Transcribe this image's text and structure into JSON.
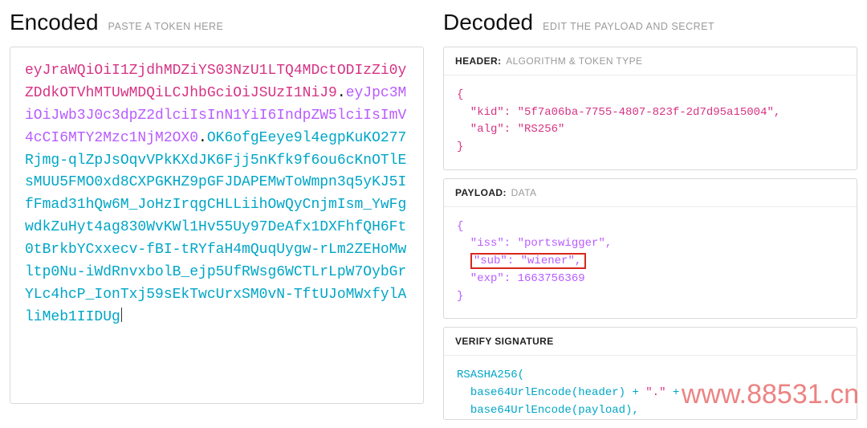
{
  "encoded": {
    "title": "Encoded",
    "subtitle": "PASTE A TOKEN HERE",
    "header": "eyJraWQiOiI1ZjdhMDZiYS03NzU1LTQ4MDctODIzZi0yZDdkOTVhMTUwMDQiLCJhbGciOiJSUzI1NiJ9",
    "payload": "eyJpc3MiOiJwb3J0c3dpZ2dlciIsInN1YiI6IndpZW5lciIsImV4cCI6MTY2Mzc1NjM2OX0",
    "signature": "OK6ofgEeye9l4egpKuKO277Rjmg-qlZpJsOqvVPkKXdJK6Fjj5nKfk9f6ou6cKnOTlEsMUU5FMO0xd8CXPGKHZ9pGFJDAPEMwToWmpn3q5yKJ5IfFmad31hQw6M_JoHzIrqgCHLLiihOwQyCnjmIsm_YwFgwdkZuHyt4ag830WvKWl1Hv55Uy97DeAfx1DXFhfQH6Ft0tBrkbYCxxecv-fBI-tRYfaH4mQuqUygw-rLm2ZEHoMwltp0Nu-iWdRnvxbolB_ejp5UfRWsg6WCTLrLpW7OybGrYLc4hcP_IonTxj59sEkTwcUrxSM0vN-TftUJoMWxfylAliMeb1IIDUg"
  },
  "decoded": {
    "title": "Decoded",
    "subtitle": "EDIT THE PAYLOAD AND SECRET",
    "header_section": {
      "label": "HEADER:",
      "desc": "ALGORITHM & TOKEN TYPE"
    },
    "payload_section": {
      "label": "PAYLOAD:",
      "desc": "DATA"
    },
    "verify_section": {
      "label": "VERIFY SIGNATURE",
      "desc": ""
    },
    "header_json": {
      "kid": "5f7a06ba-7755-4807-823f-2d7d95a15004",
      "alg": "RS256"
    },
    "payload_json": {
      "iss": "portswigger",
      "sub": "wiener",
      "exp": 1663756369
    },
    "highlight_key": "sub",
    "verify": {
      "fn": "RSASHA256(",
      "line1a": "base64UrlEncode(header)",
      "plus": " + ",
      "dot": "\".\"",
      "line2a": "base64UrlEncode(payload)",
      "comma": ","
    }
  },
  "watermarks": {
    "w1": "",
    "w2": "www.88531.cn"
  }
}
